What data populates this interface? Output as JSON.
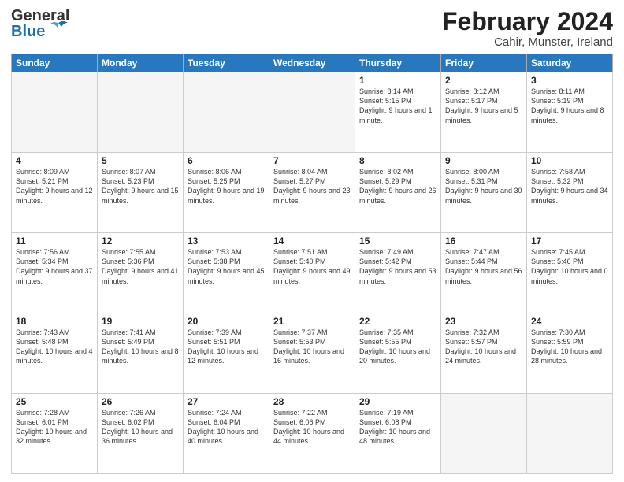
{
  "header": {
    "logo_general": "General",
    "logo_blue": "Blue",
    "title": "February 2024",
    "subtitle": "Cahir, Munster, Ireland"
  },
  "days_of_week": [
    "Sunday",
    "Monday",
    "Tuesday",
    "Wednesday",
    "Thursday",
    "Friday",
    "Saturday"
  ],
  "weeks": [
    [
      {
        "day": "",
        "info": ""
      },
      {
        "day": "",
        "info": ""
      },
      {
        "day": "",
        "info": ""
      },
      {
        "day": "",
        "info": ""
      },
      {
        "day": "1",
        "info": "Sunrise: 8:14 AM\nSunset: 5:15 PM\nDaylight: 9 hours and 1 minute."
      },
      {
        "day": "2",
        "info": "Sunrise: 8:12 AM\nSunset: 5:17 PM\nDaylight: 9 hours and 5 minutes."
      },
      {
        "day": "3",
        "info": "Sunrise: 8:11 AM\nSunset: 5:19 PM\nDaylight: 9 hours and 8 minutes."
      }
    ],
    [
      {
        "day": "4",
        "info": "Sunrise: 8:09 AM\nSunset: 5:21 PM\nDaylight: 9 hours and 12 minutes."
      },
      {
        "day": "5",
        "info": "Sunrise: 8:07 AM\nSunset: 5:23 PM\nDaylight: 9 hours and 15 minutes."
      },
      {
        "day": "6",
        "info": "Sunrise: 8:06 AM\nSunset: 5:25 PM\nDaylight: 9 hours and 19 minutes."
      },
      {
        "day": "7",
        "info": "Sunrise: 8:04 AM\nSunset: 5:27 PM\nDaylight: 9 hours and 23 minutes."
      },
      {
        "day": "8",
        "info": "Sunrise: 8:02 AM\nSunset: 5:29 PM\nDaylight: 9 hours and 26 minutes."
      },
      {
        "day": "9",
        "info": "Sunrise: 8:00 AM\nSunset: 5:31 PM\nDaylight: 9 hours and 30 minutes."
      },
      {
        "day": "10",
        "info": "Sunrise: 7:58 AM\nSunset: 5:32 PM\nDaylight: 9 hours and 34 minutes."
      }
    ],
    [
      {
        "day": "11",
        "info": "Sunrise: 7:56 AM\nSunset: 5:34 PM\nDaylight: 9 hours and 37 minutes."
      },
      {
        "day": "12",
        "info": "Sunrise: 7:55 AM\nSunset: 5:36 PM\nDaylight: 9 hours and 41 minutes."
      },
      {
        "day": "13",
        "info": "Sunrise: 7:53 AM\nSunset: 5:38 PM\nDaylight: 9 hours and 45 minutes."
      },
      {
        "day": "14",
        "info": "Sunrise: 7:51 AM\nSunset: 5:40 PM\nDaylight: 9 hours and 49 minutes."
      },
      {
        "day": "15",
        "info": "Sunrise: 7:49 AM\nSunset: 5:42 PM\nDaylight: 9 hours and 53 minutes."
      },
      {
        "day": "16",
        "info": "Sunrise: 7:47 AM\nSunset: 5:44 PM\nDaylight: 9 hours and 56 minutes."
      },
      {
        "day": "17",
        "info": "Sunrise: 7:45 AM\nSunset: 5:46 PM\nDaylight: 10 hours and 0 minutes."
      }
    ],
    [
      {
        "day": "18",
        "info": "Sunrise: 7:43 AM\nSunset: 5:48 PM\nDaylight: 10 hours and 4 minutes."
      },
      {
        "day": "19",
        "info": "Sunrise: 7:41 AM\nSunset: 5:49 PM\nDaylight: 10 hours and 8 minutes."
      },
      {
        "day": "20",
        "info": "Sunrise: 7:39 AM\nSunset: 5:51 PM\nDaylight: 10 hours and 12 minutes."
      },
      {
        "day": "21",
        "info": "Sunrise: 7:37 AM\nSunset: 5:53 PM\nDaylight: 10 hours and 16 minutes."
      },
      {
        "day": "22",
        "info": "Sunrise: 7:35 AM\nSunset: 5:55 PM\nDaylight: 10 hours and 20 minutes."
      },
      {
        "day": "23",
        "info": "Sunrise: 7:32 AM\nSunset: 5:57 PM\nDaylight: 10 hours and 24 minutes."
      },
      {
        "day": "24",
        "info": "Sunrise: 7:30 AM\nSunset: 5:59 PM\nDaylight: 10 hours and 28 minutes."
      }
    ],
    [
      {
        "day": "25",
        "info": "Sunrise: 7:28 AM\nSunset: 6:01 PM\nDaylight: 10 hours and 32 minutes."
      },
      {
        "day": "26",
        "info": "Sunrise: 7:26 AM\nSunset: 6:02 PM\nDaylight: 10 hours and 36 minutes."
      },
      {
        "day": "27",
        "info": "Sunrise: 7:24 AM\nSunset: 6:04 PM\nDaylight: 10 hours and 40 minutes."
      },
      {
        "day": "28",
        "info": "Sunrise: 7:22 AM\nSunset: 6:06 PM\nDaylight: 10 hours and 44 minutes."
      },
      {
        "day": "29",
        "info": "Sunrise: 7:19 AM\nSunset: 6:08 PM\nDaylight: 10 hours and 48 minutes."
      },
      {
        "day": "",
        "info": ""
      },
      {
        "day": "",
        "info": ""
      }
    ]
  ]
}
